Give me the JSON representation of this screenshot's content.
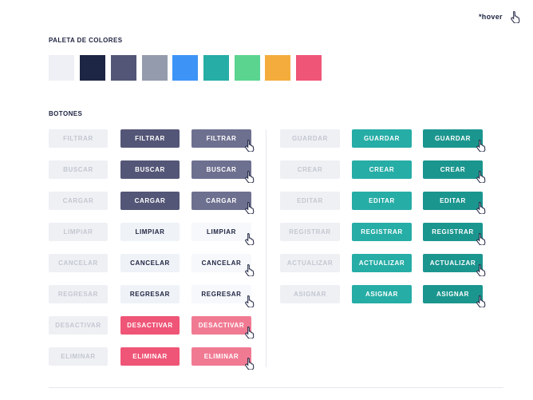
{
  "hover_note": "*hover",
  "palette": {
    "title": "PALETA DE COLORES",
    "colors": [
      "#eef0f5",
      "#1e2645",
      "#545677",
      "#939bad",
      "#3d94f6",
      "#26ada6",
      "#5bd48f",
      "#f4ad3d",
      "#ef5577"
    ]
  },
  "buttons": {
    "title": "BOTONES",
    "col1": [
      "FILTRAR",
      "BUSCAR",
      "CARGAR",
      "LIMPIAR",
      "CANCELAR",
      "REGRESAR",
      "DESACTIVAR",
      "ELIMINAR"
    ],
    "col2": [
      "FILTRAR",
      "BUSCAR",
      "CARGAR",
      "LIMPIAR",
      "CANCELAR",
      "REGRESAR",
      "DESACTIVAR",
      "ELIMINAR"
    ],
    "col3": [
      "FILTRAR",
      "BUSCAR",
      "CARGAR",
      "LIMPIAR",
      "CANCELAR",
      "REGRESAR",
      "DESACTIVAR",
      "ELIMINAR"
    ],
    "col4": [
      "GUARDAR",
      "CREAR",
      "EDITAR",
      "REGISTRAR",
      "ACTUALIZAR",
      "ASIGNAR"
    ],
    "col5": [
      "GUARDAR",
      "CREAR",
      "EDITAR",
      "REGISTRAR",
      "ACTUALIZAR",
      "ASIGNAR"
    ],
    "col6": [
      "GUARDAR",
      "CREAR",
      "EDITAR",
      "REGISTRAR",
      "ACTUALIZAR",
      "ASIGNAR"
    ]
  },
  "icons": {
    "cursor": "hand-pointer-icon"
  }
}
